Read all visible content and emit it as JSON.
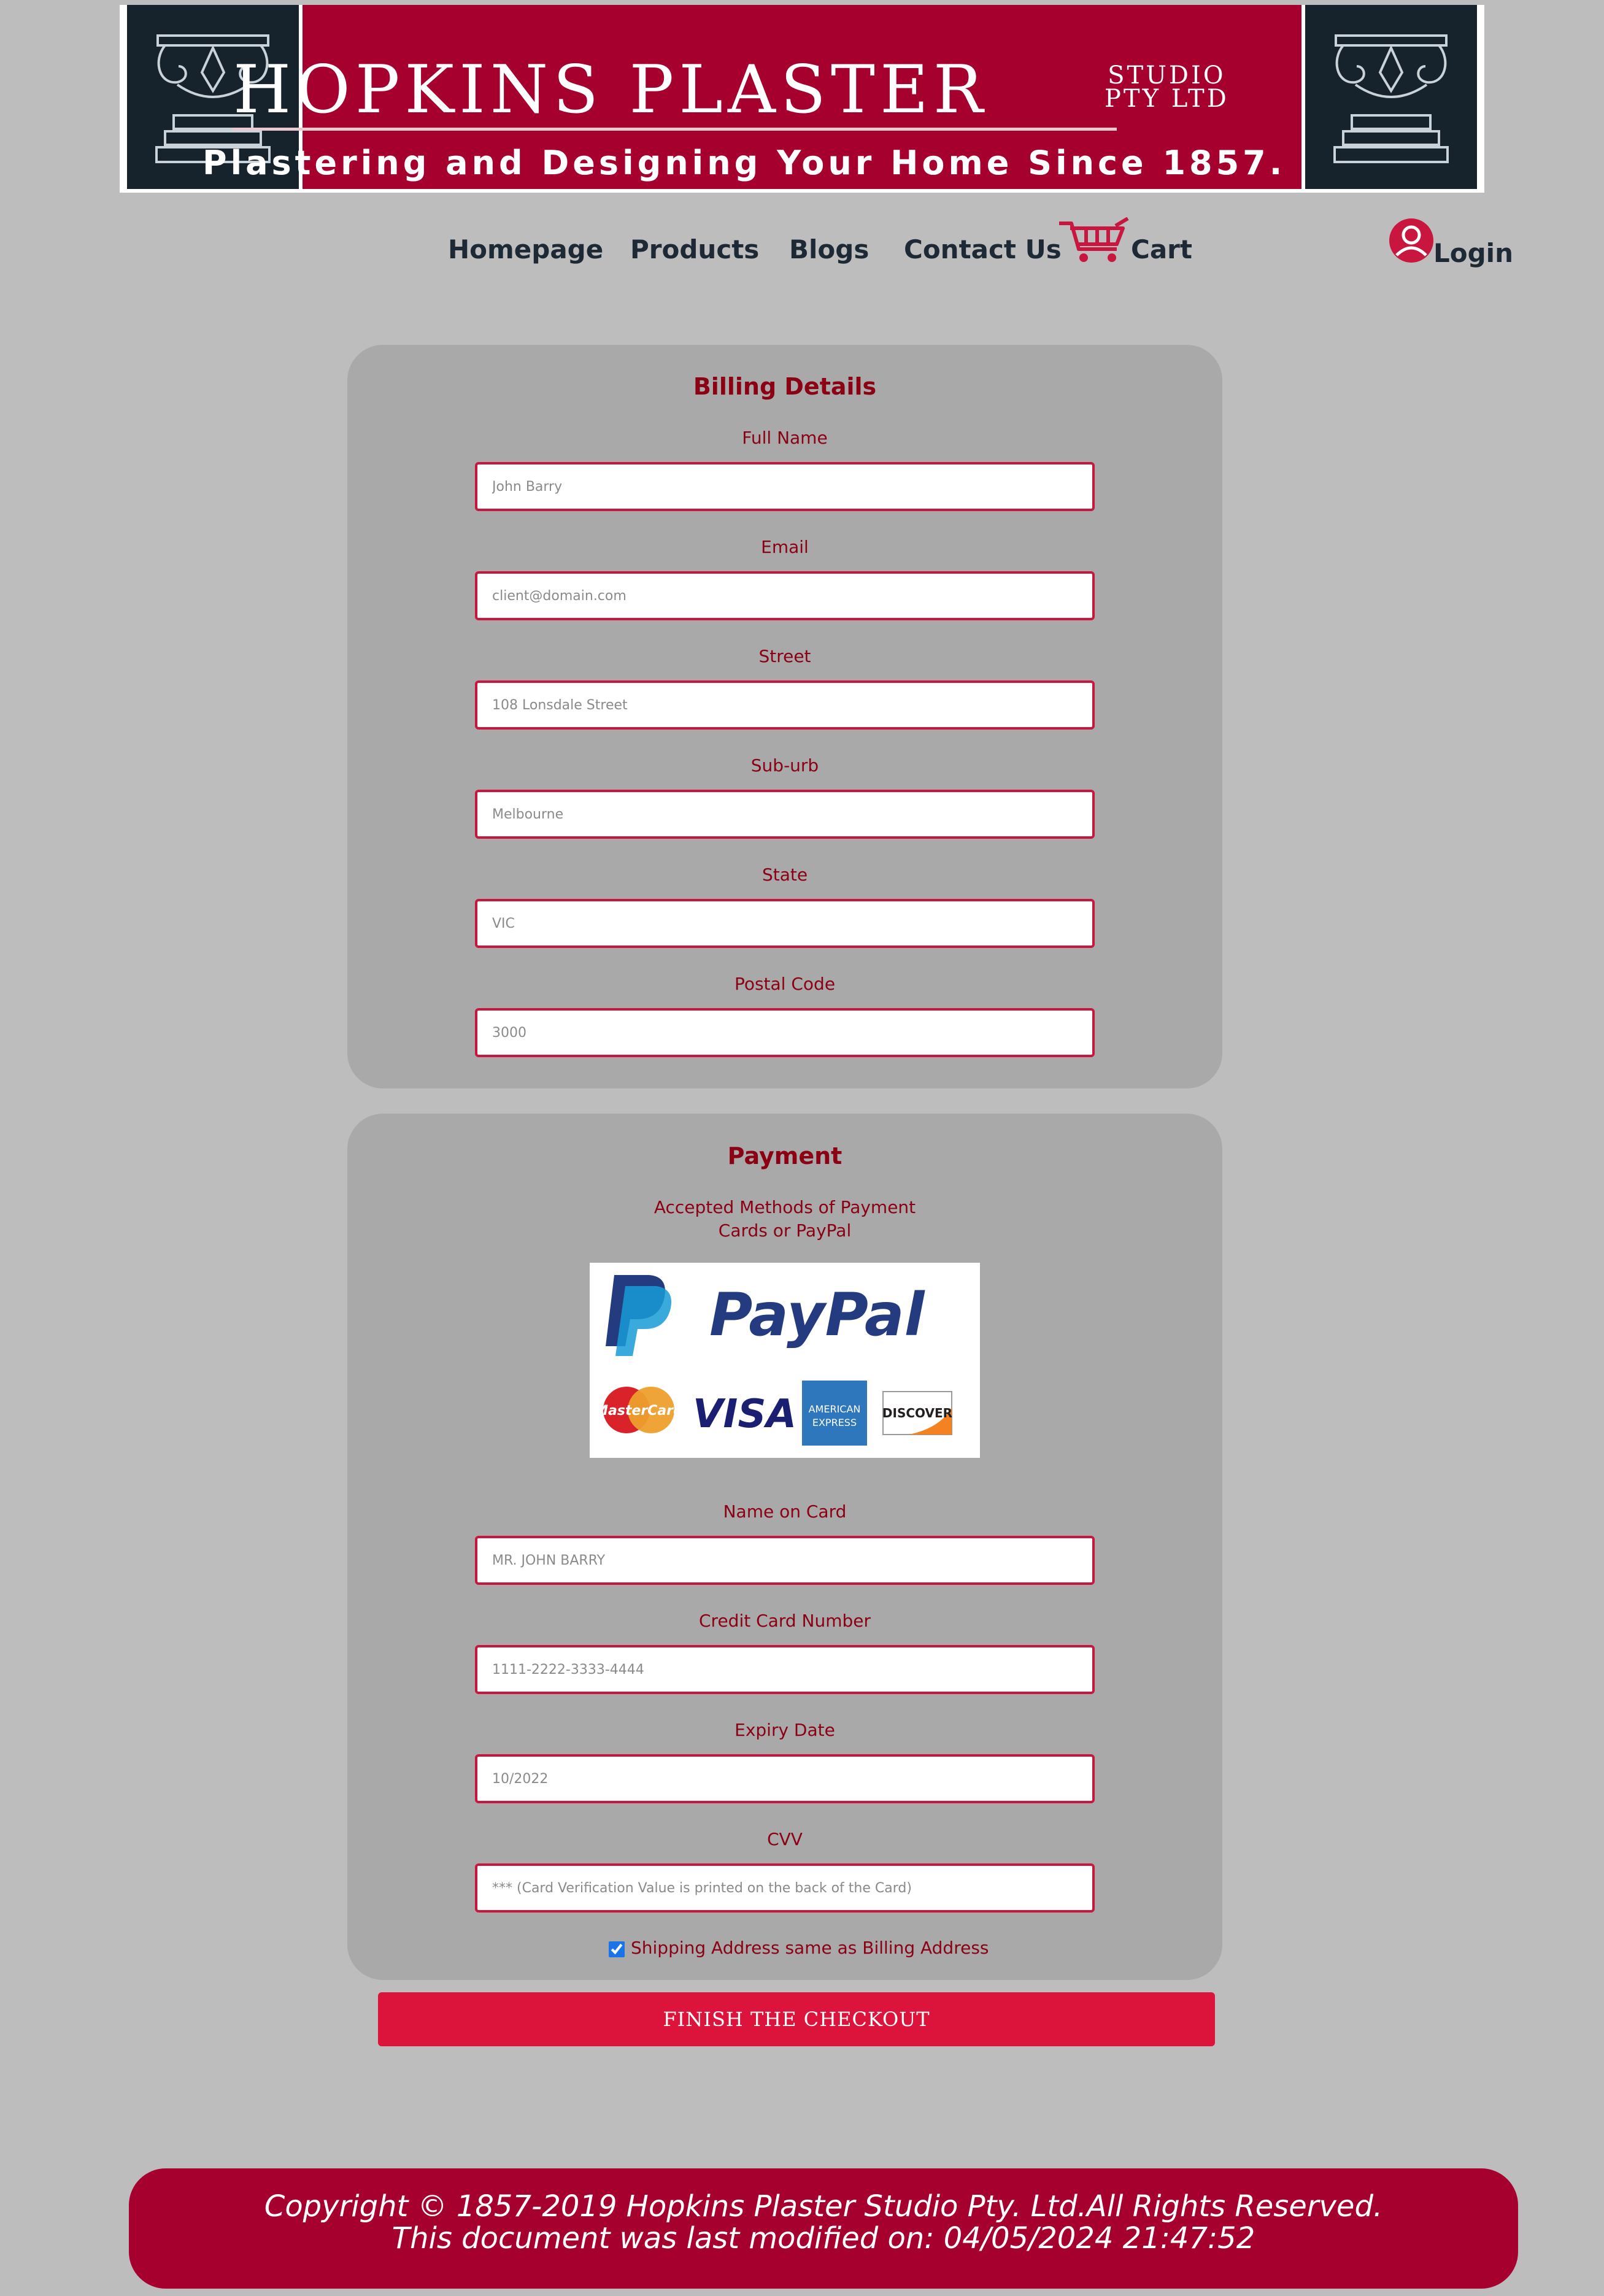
{
  "header": {
    "brand_name": "HOPKINS PLASTER",
    "brand_suffix_line1": "STUDIO",
    "brand_suffix_line2": "PTY LTD",
    "tagline": "Plastering and Designing Your Home Since 1857."
  },
  "nav": {
    "items": [
      {
        "label": "Homepage"
      },
      {
        "label": "Products"
      },
      {
        "label": "Blogs"
      },
      {
        "label": "Contact Us"
      },
      {
        "label": "Cart",
        "icon": "shopping-cart-icon"
      }
    ],
    "login": {
      "label": "Login",
      "icon": "user-icon"
    }
  },
  "billing": {
    "title": "Billing Details",
    "fields": [
      {
        "label": "Full Name",
        "placeholder": "John Barry"
      },
      {
        "label": "Email",
        "placeholder": "client@domain.com"
      },
      {
        "label": "Street",
        "placeholder": "108 Lonsdale Street"
      },
      {
        "label": "Sub-urb",
        "placeholder": "Melbourne"
      },
      {
        "label": "State",
        "placeholder": "VIC"
      },
      {
        "label": "Postal Code",
        "placeholder": "3000"
      }
    ]
  },
  "payment": {
    "title": "Payment",
    "accepted_line1": "Accepted Methods of Payment",
    "accepted_line2": "Cards or PayPal",
    "logos": {
      "paypal": "PayPal",
      "mastercard": "MasterCard",
      "visa": "VISA",
      "amex_line1": "AMERICAN",
      "amex_line2": "EXPRESS",
      "discover": "DISCOVER"
    },
    "fields": [
      {
        "label": "Name on Card",
        "placeholder": "MR. JOHN BARRY"
      },
      {
        "label": "Credit Card Number",
        "placeholder": "1111-2222-3333-4444"
      },
      {
        "label": "Expiry Date",
        "placeholder": "10/2022"
      },
      {
        "label": "CVV",
        "placeholder": "*** (Card Verification Value is printed on the back of the Card)"
      }
    ],
    "shipping_same_label": "Shipping Address same as Billing Address",
    "shipping_same_checked": true
  },
  "checkout_button": "FINISH THE CHECKOUT",
  "footer": {
    "copyright": "Copyright © 1857-2019 Hopkins Plaster Studio Pty. Ltd.All Rights Reserved.",
    "modified": "This document was last modified on: 04/05/2024 21:47:52"
  },
  "colors": {
    "brand": "#a6002f",
    "accent_button": "#dc143c",
    "label_text": "#8b0012",
    "page_bg": "#bdbdbd",
    "panel_bg": "#a9a9a9"
  }
}
